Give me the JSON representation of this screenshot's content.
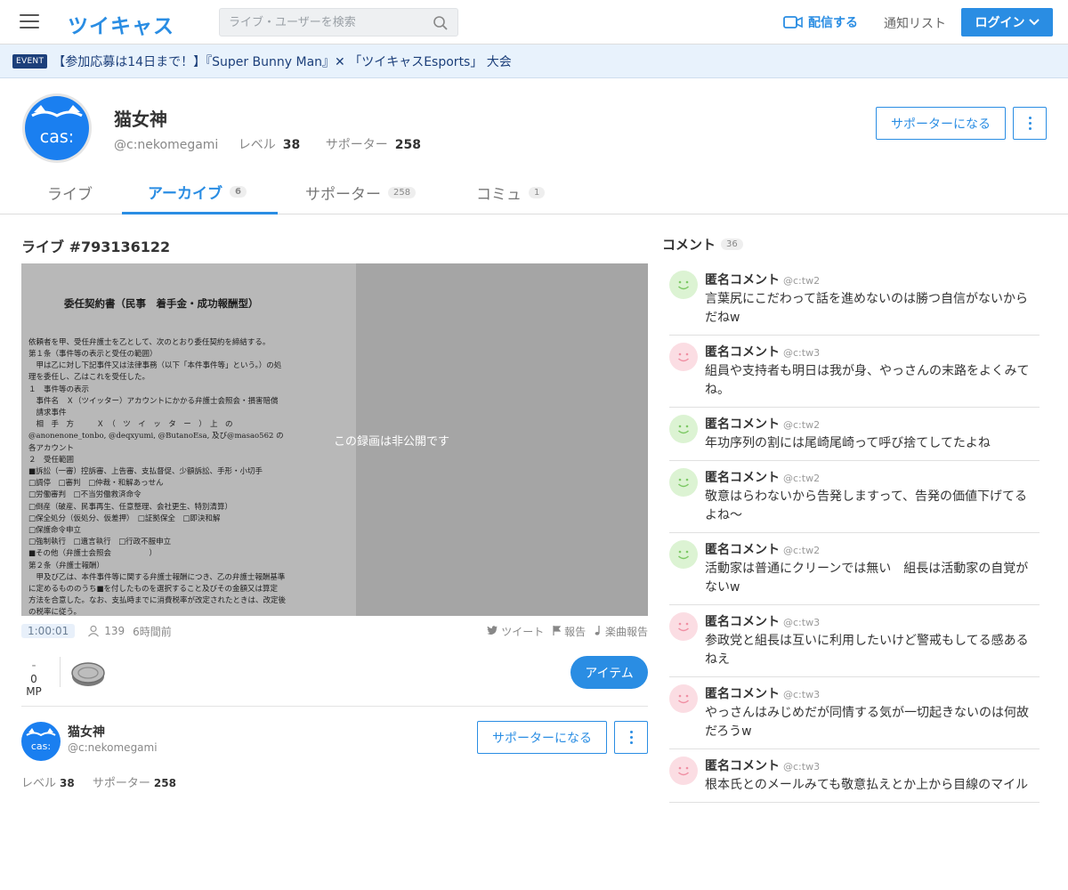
{
  "header": {
    "logo": "ツイキャス",
    "search_placeholder": "ライブ・ユーザーを検索",
    "broadcast_label": "配信する",
    "notify_label": "通知リスト",
    "login_label": "ログイン"
  },
  "event": {
    "badge": "EVENT",
    "text": "【参加応募は14日まで！】『Super Bunny Man』✕ 「ツイキャスEsports」 大会󠄀"
  },
  "profile": {
    "name": "猫女神",
    "handle": "@c:nekomegami",
    "level_label": "レベル",
    "level": "38",
    "supporter_label": "サポーター",
    "supporters": "258",
    "avatar_text": "cas:",
    "support_button": "サポーターになる"
  },
  "tabs": [
    {
      "label": "ライブ",
      "count": ""
    },
    {
      "label": "アーカイブ",
      "count": "6"
    },
    {
      "label": "サポーター",
      "count": "258"
    },
    {
      "label": "コミュ",
      "count": "1"
    }
  ],
  "live": {
    "title": "ライブ #793136122",
    "private_text": "この録画は非公開です",
    "duration": "1:00:01",
    "viewers": "139",
    "time_ago": "6時間前",
    "tweet_label": "ツイート",
    "report_label": "報告",
    "music_report_label": "楽曲報告",
    "mp_dash": "-",
    "mp_label": "0 MP",
    "item_button": "アイテム",
    "doc": {
      "title": "委任契約書（民事　着手金・成功報酬型）",
      "body": "依頼者を甲、受任弁護士を乙として、次のとおり委任契約を締結する。\n第１条（事件等の表示と受任の範囲）\n　甲は乙に対し下記事件又は法律事務（以下「本件事件等」という。）の処\n理を委任し、乙はこれを受任した。\n１　事件等の表示\n　事件名　Ｘ（ツイッター）アカウントにかかる弁護士会照会・損害賠償\n　請求事件\n　相　手　方　　　Ｘ　（　ツ　イ　ッ　タ　ー　）　上　の\n@anonenone_tonbo, @deqxyumi, @ButanoEsa, 及び@masao562 の\n各アカウント\n２　受任範囲\n■訴訟（一審）控訴審、上告審、支払督促、少額訴訟、手形・小切手\n□調停　□審判　□仲裁・和解あっせん\n□労働審判　□不当労働救済命令\n□倒産（破産、民事再生、任意整理、会社更生、特別清算）\n□保全処分（仮処分、仮差押）　□証拠保全　□即決和解\n□保護命令申立\n□強制執行　□遺言執行　□行政不服申立\n■その他（弁護士会照会　　　　　）\n第２条（弁護士報酬）\n　甲及び乙は、本件事件等に関する弁護士報酬につき、乙の弁護士報酬基準\nに定めるもののうち■を付したものを選択すること及びその金額又は算定\n方法を合意した。なお、支払時までに消費税率が改定されたときは、改定後\nの税率に従う。\n　■着手金"
    }
  },
  "comments_header": {
    "label": "コメント",
    "count": "36"
  },
  "comments": [
    {
      "name": "匿名コメント",
      "id": "@c:tw2",
      "color": "green",
      "text": "言葉尻にこだわって話を進めないのは勝つ自信がないからだねw"
    },
    {
      "name": "匿名コメント",
      "id": "@c:tw3",
      "color": "pink",
      "text": "組員や支持者も明日は我が身、やっさんの末路をよくみてね。"
    },
    {
      "name": "匿名コメント",
      "id": "@c:tw2",
      "color": "green",
      "text": "年功序列の割には尾崎尾崎って呼び捨てしてたよね"
    },
    {
      "name": "匿名コメント",
      "id": "@c:tw2",
      "color": "green",
      "text": "敬意はらわないから告発しますって、告発の価値下げてるよね〜"
    },
    {
      "name": "匿名コメント",
      "id": "@c:tw2",
      "color": "green",
      "text": "活動家は普通にクリーンでは無い　組長は活動家の自覚がないw"
    },
    {
      "name": "匿名コメント",
      "id": "@c:tw3",
      "color": "pink",
      "text": "参政党と組長は互いに利用したいけど警戒もしてる感あるねえ"
    },
    {
      "name": "匿名コメント",
      "id": "@c:tw3",
      "color": "pink",
      "text": "やっさんはみじめだが同情する気が一切起きないのは何故だろうw"
    },
    {
      "name": "匿名コメント",
      "id": "@c:tw3",
      "color": "pink",
      "text": "根本氏とのメールみても敬意払えとか上から目線のマイル"
    }
  ],
  "colors": {
    "accent": "#2a8de3",
    "event_bg": "#e8f2fc",
    "event_text": "#1c3f7a"
  }
}
